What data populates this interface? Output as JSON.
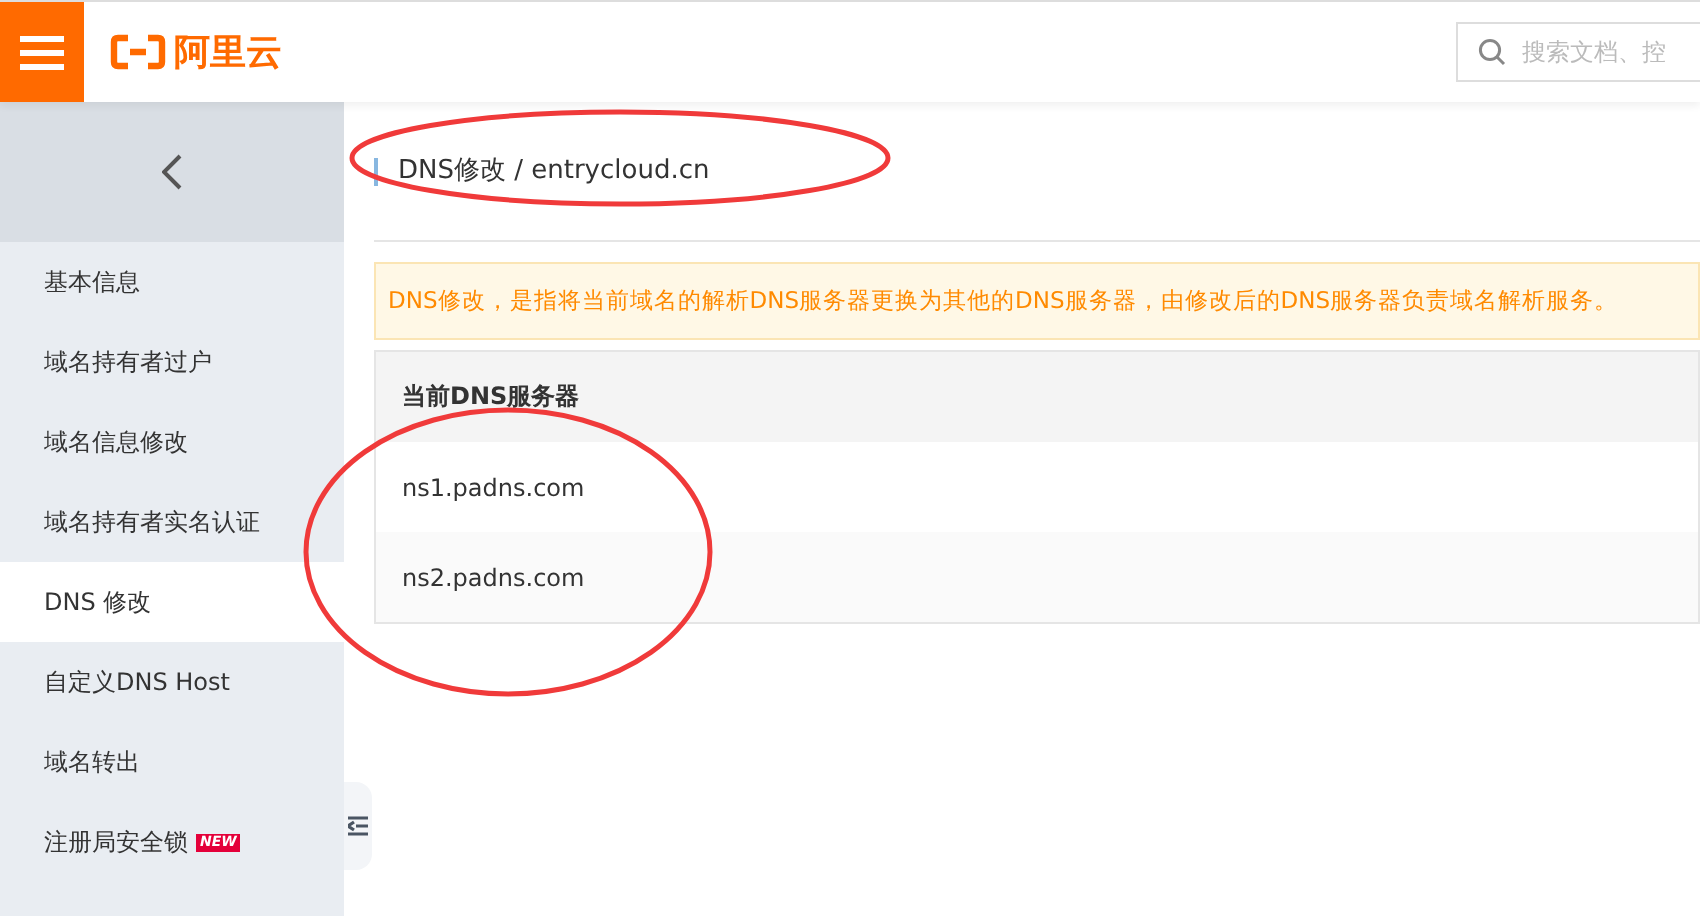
{
  "header": {
    "logo": "阿里云",
    "search": {
      "placeholder": "搜索文档、控"
    }
  },
  "sidebar": {
    "items": [
      {
        "label": "基本信息",
        "selected": false
      },
      {
        "label": "域名持有者过户",
        "selected": false
      },
      {
        "label": "域名信息修改",
        "selected": false
      },
      {
        "label": "域名持有者实名认证",
        "selected": false
      },
      {
        "label": "DNS 修改",
        "selected": true
      },
      {
        "label": "自定义DNS Host",
        "selected": false
      },
      {
        "label": "域名转出",
        "selected": false
      },
      {
        "label": "注册局安全锁",
        "selected": false,
        "badge": "NEW"
      }
    ]
  },
  "breadcrumb": "DNS修改 / entrycloud.cn",
  "notice": "DNS修改，是指将当前域名的解析DNS服务器更换为其他的DNS服务器，由修改后的DNS服务器负责域名解析服务。",
  "table": {
    "columns": [
      "当前DNS服务器"
    ],
    "rows": [
      "ns1.padns.com",
      "ns2.padns.com"
    ]
  }
}
